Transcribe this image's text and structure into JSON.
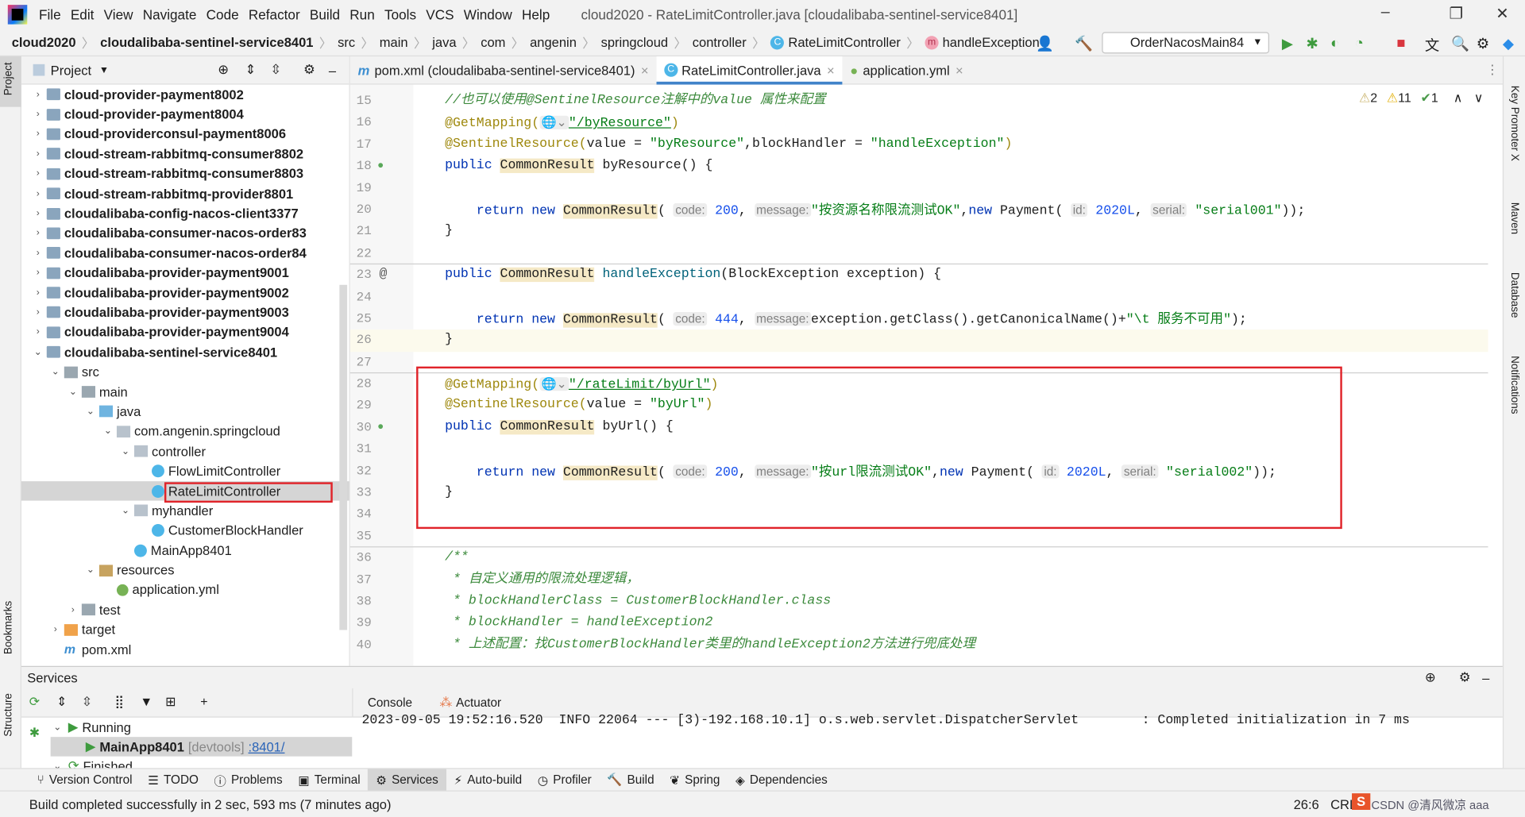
{
  "window": {
    "title": "cloud2020 - RateLimitController.java [cloudalibaba-sentinel-service8401]"
  },
  "menu": [
    "File",
    "Edit",
    "View",
    "Navigate",
    "Code",
    "Refactor",
    "Build",
    "Run",
    "Tools",
    "VCS",
    "Window",
    "Help"
  ],
  "breadcrumb": [
    "cloud2020",
    "cloudalibaba-sentinel-service8401",
    "src",
    "main",
    "java",
    "com",
    "angenin",
    "springcloud",
    "controller",
    "RateLimitController",
    "handleException"
  ],
  "toolbar": {
    "run_config": "OrderNacosMain84"
  },
  "left_strip": {
    "project": "Project",
    "bookmarks": "Bookmarks",
    "structure": "Structure"
  },
  "right_strip": [
    "Key Promoter X",
    "Maven",
    "Database",
    "Notifications"
  ],
  "project": {
    "title": "Project",
    "tree": [
      {
        "l": 1,
        "a": "›",
        "i": "mod",
        "t": "cloud-provider-payment8002",
        "b": true
      },
      {
        "l": 1,
        "a": "›",
        "i": "mod",
        "t": "cloud-provider-payment8004",
        "b": true
      },
      {
        "l": 1,
        "a": "›",
        "i": "mod",
        "t": "cloud-providerconsul-payment8006",
        "b": true
      },
      {
        "l": 1,
        "a": "›",
        "i": "mod",
        "t": "cloud-stream-rabbitmq-consumer8802",
        "b": true
      },
      {
        "l": 1,
        "a": "›",
        "i": "mod",
        "t": "cloud-stream-rabbitmq-consumer8803",
        "b": true
      },
      {
        "l": 1,
        "a": "›",
        "i": "mod",
        "t": "cloud-stream-rabbitmq-provider8801",
        "b": true
      },
      {
        "l": 1,
        "a": "›",
        "i": "mod",
        "t": "cloudalibaba-config-nacos-client3377",
        "b": true
      },
      {
        "l": 1,
        "a": "›",
        "i": "mod",
        "t": "cloudalibaba-consumer-nacos-order83",
        "b": true
      },
      {
        "l": 1,
        "a": "›",
        "i": "mod",
        "t": "cloudalibaba-consumer-nacos-order84",
        "b": true
      },
      {
        "l": 1,
        "a": "›",
        "i": "mod",
        "t": "cloudalibaba-provider-payment9001",
        "b": true
      },
      {
        "l": 1,
        "a": "›",
        "i": "mod",
        "t": "cloudalibaba-provider-payment9002",
        "b": true
      },
      {
        "l": 1,
        "a": "›",
        "i": "mod",
        "t": "cloudalibaba-provider-payment9003",
        "b": true
      },
      {
        "l": 1,
        "a": "›",
        "i": "mod",
        "t": "cloudalibaba-provider-payment9004",
        "b": true
      },
      {
        "l": 1,
        "a": "⌄",
        "i": "mod",
        "t": "cloudalibaba-sentinel-service8401",
        "b": true
      },
      {
        "l": 2,
        "a": "⌄",
        "i": "fold",
        "t": "src"
      },
      {
        "l": 3,
        "a": "⌄",
        "i": "fold",
        "t": "main"
      },
      {
        "l": 4,
        "a": "⌄",
        "i": "src",
        "t": "java"
      },
      {
        "l": 5,
        "a": "⌄",
        "i": "pkg",
        "t": "com.angenin.springcloud"
      },
      {
        "l": 6,
        "a": "⌄",
        "i": "pkg",
        "t": "controller"
      },
      {
        "l": 7,
        "a": "",
        "i": "cls",
        "t": "FlowLimitController"
      },
      {
        "l": 7,
        "a": "",
        "i": "cls",
        "t": "RateLimitController",
        "sel": true
      },
      {
        "l": 6,
        "a": "⌄",
        "i": "pkg",
        "t": "myhandler"
      },
      {
        "l": 7,
        "a": "",
        "i": "cls",
        "t": "CustomerBlockHandler"
      },
      {
        "l": 6,
        "a": "",
        "i": "cls",
        "t": "MainApp8401"
      },
      {
        "l": 4,
        "a": "⌄",
        "i": "res",
        "t": "resources"
      },
      {
        "l": 5,
        "a": "",
        "i": "yml",
        "t": "application.yml"
      },
      {
        "l": 3,
        "a": "›",
        "i": "fold",
        "t": "test"
      },
      {
        "l": 2,
        "a": "›",
        "i": "tgt",
        "t": "target"
      },
      {
        "l": 2,
        "a": "",
        "i": "pom",
        "t": "pom.xml"
      }
    ]
  },
  "editor": {
    "tabs": [
      {
        "label": "pom.xml (cloudalibaba-sentinel-service8401)",
        "icon": "maven-icon"
      },
      {
        "label": "RateLimitController.java",
        "icon": "class-icon",
        "active": true
      },
      {
        "label": "application.yml",
        "icon": "spring-yml-icon"
      }
    ],
    "inspections": {
      "weak_warnings": "2",
      "warnings": "11",
      "typos": "1"
    },
    "lines": [
      {
        "n": "15",
        "t": [
          [
            "cmt",
            "    //也可以使用@SentinelResource注解中的value 属性来配置"
          ]
        ]
      },
      {
        "n": "16",
        "t": [
          [
            "ann",
            "    @GetMapping("
          ],
          [
            "hint",
            "🌐⌄"
          ],
          [
            "str url",
            "\"/byResource\""
          ],
          [
            "ann",
            ")"
          ]
        ]
      },
      {
        "n": "17",
        "t": [
          [
            "ann",
            "    @SentinelResource("
          ],
          [
            "",
            "value = "
          ],
          [
            "str",
            "\"byResource\""
          ],
          [
            "",
            ",blockHandler = "
          ],
          [
            "str",
            "\"handleException\""
          ],
          [
            "ann",
            ")"
          ]
        ]
      },
      {
        "n": "18",
        "t": [
          [
            "kw",
            "    public "
          ],
          [
            "hl",
            "CommonResult"
          ],
          [
            "",
            " byResource() {"
          ]
        ]
      },
      {
        "n": "19",
        "t": []
      },
      {
        "n": "20",
        "t": [
          [
            "kw",
            "        return new "
          ],
          [
            "hl",
            "CommonResult"
          ],
          [
            "",
            "( "
          ],
          [
            "hint",
            "code:"
          ],
          [
            "numv",
            " 200"
          ],
          [
            "",
            ", "
          ],
          [
            "hint",
            "message:"
          ],
          [
            "str",
            "\"按资源名称限流测试OK\""
          ],
          [
            "",
            ","
          ],
          [
            "kw",
            "new "
          ],
          [
            "",
            "Payment( "
          ],
          [
            "hint",
            "id:"
          ],
          [
            "numv",
            " 2020L"
          ],
          [
            "",
            ", "
          ],
          [
            "hint",
            "serial:"
          ],
          [
            "str",
            " \"serial001\""
          ],
          [
            "",
            "));"
          ]
        ]
      },
      {
        "n": "21",
        "t": [
          [
            "",
            "    }"
          ]
        ]
      },
      {
        "n": "22",
        "t": [],
        "sep": true
      },
      {
        "n": "23",
        "t": [
          [
            "kw",
            "    public "
          ],
          [
            "hl",
            "CommonResult"
          ],
          [
            "fn",
            " handleException"
          ],
          [
            "",
            "(BlockException exception) {"
          ]
        ]
      },
      {
        "n": "24",
        "t": []
      },
      {
        "n": "25",
        "t": [
          [
            "kw",
            "        return new "
          ],
          [
            "hl",
            "CommonResult"
          ],
          [
            "",
            "( "
          ],
          [
            "hint",
            "code:"
          ],
          [
            "numv",
            " 444"
          ],
          [
            "",
            ", "
          ],
          [
            "hint",
            "message:"
          ],
          [
            "",
            "exception.getClass().getCanonicalName()+"
          ],
          [
            "str",
            "\"\\t 服务不可用\""
          ],
          [
            "",
            ");"
          ]
        ]
      },
      {
        "n": "26",
        "t": [
          [
            "",
            "    }"
          ]
        ],
        "cur": true
      },
      {
        "n": "27",
        "t": [],
        "sep": true
      },
      {
        "n": "28",
        "t": [
          [
            "ann",
            "    @GetMapping("
          ],
          [
            "hint",
            "🌐⌄"
          ],
          [
            "str url",
            "\"/rateLimit/byUrl\""
          ],
          [
            "ann",
            ")"
          ]
        ]
      },
      {
        "n": "29",
        "t": [
          [
            "ann",
            "    @SentinelResource("
          ],
          [
            "",
            "value = "
          ],
          [
            "str",
            "\"byUrl\""
          ],
          [
            "ann",
            ")"
          ]
        ]
      },
      {
        "n": "30",
        "t": [
          [
            "kw",
            "    public "
          ],
          [
            "hl",
            "CommonResult"
          ],
          [
            "",
            " byUrl() {"
          ]
        ]
      },
      {
        "n": "31",
        "t": []
      },
      {
        "n": "32",
        "t": [
          [
            "kw",
            "        return new "
          ],
          [
            "hl",
            "CommonResult"
          ],
          [
            "",
            "( "
          ],
          [
            "hint",
            "code:"
          ],
          [
            "numv",
            " 200"
          ],
          [
            "",
            ", "
          ],
          [
            "hint",
            "message:"
          ],
          [
            "str",
            "\"按url限流测试OK\""
          ],
          [
            "",
            ","
          ],
          [
            "kw",
            "new "
          ],
          [
            "",
            "Payment( "
          ],
          [
            "hint",
            "id:"
          ],
          [
            "numv",
            " 2020L"
          ],
          [
            "",
            ", "
          ],
          [
            "hint",
            "serial:"
          ],
          [
            "str",
            " \"serial002\""
          ],
          [
            "",
            "));"
          ]
        ]
      },
      {
        "n": "33",
        "t": [
          [
            "",
            "    }"
          ]
        ]
      },
      {
        "n": "34",
        "t": []
      },
      {
        "n": "35",
        "t": [],
        "sep": true
      },
      {
        "n": "36",
        "t": [
          [
            "cmt",
            "    /**"
          ]
        ]
      },
      {
        "n": "37",
        "t": [
          [
            "cmt",
            "     * 自定义通用的限流处理逻辑，"
          ]
        ]
      },
      {
        "n": "38",
        "t": [
          [
            "cmt",
            "     * blockHandlerClass = CustomerBlockHandler.class"
          ]
        ]
      },
      {
        "n": "39",
        "t": [
          [
            "cmt",
            "     * blockHandler = handleException2"
          ]
        ]
      },
      {
        "n": "40",
        "t": [
          [
            "cmt",
            "     * 上述配置：找CustomerBlockHandler类里的handleException2方法进行兜底处理"
          ]
        ]
      }
    ]
  },
  "services": {
    "title": "Services",
    "running": "Running",
    "app": "MainApp8401",
    "devtools": "[devtools]",
    "port": ":8401/",
    "finished": "Finished",
    "tabs": [
      "Console",
      "Actuator"
    ],
    "console_line": "2023-09-05 19:52:16.520  INFO 22064 --- [3)-192.168.10.1] o.s.web.servlet.DispatcherServlet        : Completed initialization in 7 ms"
  },
  "bottom_tabs": [
    "Version Control",
    "TODO",
    "Problems",
    "Terminal",
    "Services",
    "Auto-build",
    "Profiler",
    "Build",
    "Spring",
    "Dependencies"
  ],
  "status": {
    "message": "Build completed successfully in 2 sec, 593 ms (7 minutes ago)",
    "position": "26:6",
    "line_sep": "CRLF"
  },
  "watermark": "CSDN @清风微凉 aaa"
}
